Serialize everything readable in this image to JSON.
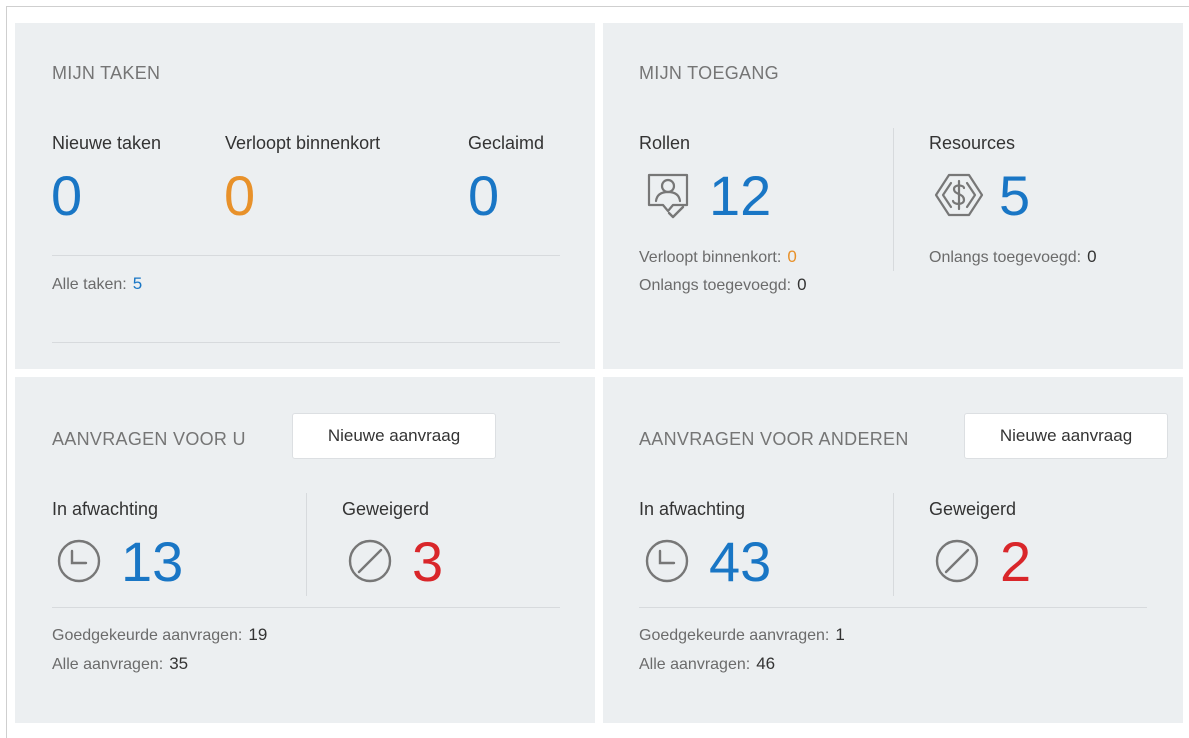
{
  "my_tasks": {
    "title": "MIJN TAKEN",
    "new_label": "Nieuwe taken",
    "new_value": "0",
    "expiring_label": "Verloopt binnenkort",
    "expiring_value": "0",
    "claimed_label": "Geclaimd",
    "claimed_value": "0",
    "all_label": "Alle taken:",
    "all_value": "5"
  },
  "my_access": {
    "title": "MIJN TOEGANG",
    "roles_label": "Rollen",
    "roles_value": "12",
    "roles_expiring_label": "Verloopt binnenkort:",
    "roles_expiring_value": "0",
    "roles_recent_label": "Onlangs toegevoegd:",
    "roles_recent_value": "0",
    "resources_label": "Resources",
    "resources_value": "5",
    "resources_recent_label": "Onlangs toegevoegd:",
    "resources_recent_value": "0"
  },
  "requests_for_you": {
    "title": "AANVRAGEN VOOR U",
    "new_button": "Nieuwe aanvraag",
    "pending_label": "In afwachting",
    "pending_value": "13",
    "denied_label": "Geweigerd",
    "denied_value": "3",
    "approved_label": "Goedgekeurde aanvragen:",
    "approved_value": "19",
    "all_label": "Alle aanvragen:",
    "all_value": "35"
  },
  "requests_for_others": {
    "title": "AANVRAGEN VOOR ANDEREN",
    "new_button": "Nieuwe aanvraag",
    "pending_label": "In afwachting",
    "pending_value": "43",
    "denied_label": "Geweigerd",
    "denied_value": "2",
    "approved_label": "Goedgekeurde aanvragen:",
    "approved_value": "1",
    "all_label": "Alle aanvragen:",
    "all_value": "46"
  },
  "icons": {
    "roles": "role-badge-icon",
    "resources": "resource-dollar-icon",
    "pending": "clock-icon",
    "denied": "denied-circle-icon"
  },
  "colors": {
    "accent_blue": "#1976c5",
    "warning_orange": "#e8912a",
    "danger_red": "#d9262a",
    "card_background": "#eceff1"
  }
}
